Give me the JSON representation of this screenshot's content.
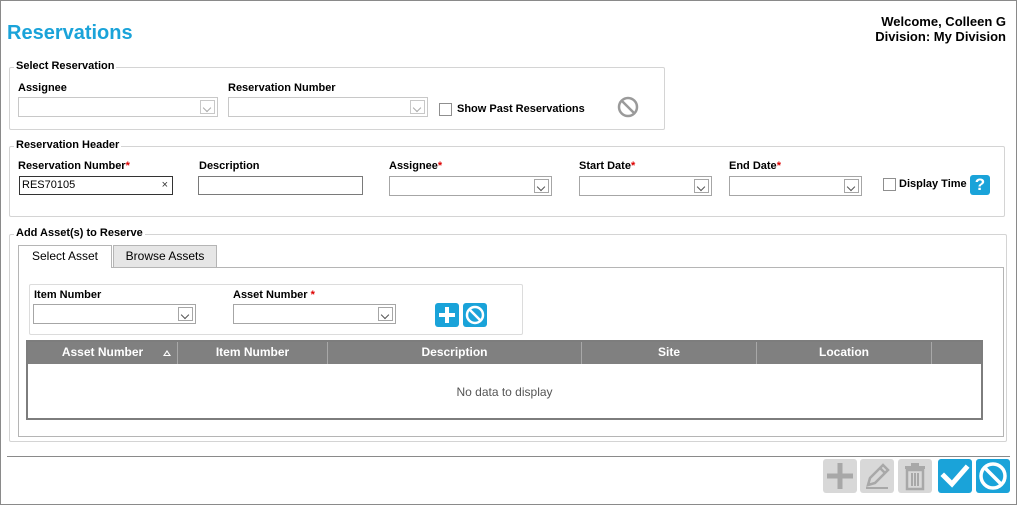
{
  "page": {
    "title": "Reservations",
    "welcome": "Welcome, Colleen G",
    "division": "Division: My Division"
  },
  "select_reservation": {
    "legend": "Select Reservation",
    "assignee_label": "Assignee",
    "assignee_value": "",
    "reservation_number_label": "Reservation Number",
    "reservation_number_value": "",
    "show_past_label": "Show Past Reservations",
    "show_past_checked": false
  },
  "reservation_header": {
    "legend": "Reservation Header",
    "reservation_number_label": "Reservation Number",
    "reservation_number_value": "RES70105",
    "clear_glyph": "×",
    "description_label": "Description",
    "description_value": "",
    "assignee_label": "Assignee",
    "start_date_label": "Start Date",
    "end_date_label": "End Date",
    "required_mark": "*",
    "display_time_label": "Display Time",
    "display_time_checked": false,
    "help_glyph": "?"
  },
  "add_assets": {
    "legend": "Add Asset(s) to Reserve",
    "tabs": [
      {
        "label": "Select Asset",
        "active": true
      },
      {
        "label": "Browse Assets",
        "active": false
      }
    ],
    "item_number_label": "Item Number",
    "asset_number_label": "Asset Number",
    "required_mark": "*",
    "grid": {
      "columns": [
        "Asset Number",
        "Item Number",
        "Description",
        "Site",
        "Location"
      ],
      "sorted_column": "Asset Number",
      "empty_text": "No data to display"
    }
  },
  "toolbar": {
    "buttons": [
      "plus-icon",
      "pencil-icon",
      "trash-icon",
      "check-icon",
      "ban-icon"
    ]
  },
  "colors": {
    "accent": "#1aa3d9",
    "disabled": "#d8d8d8",
    "grid_header": "#808080"
  }
}
